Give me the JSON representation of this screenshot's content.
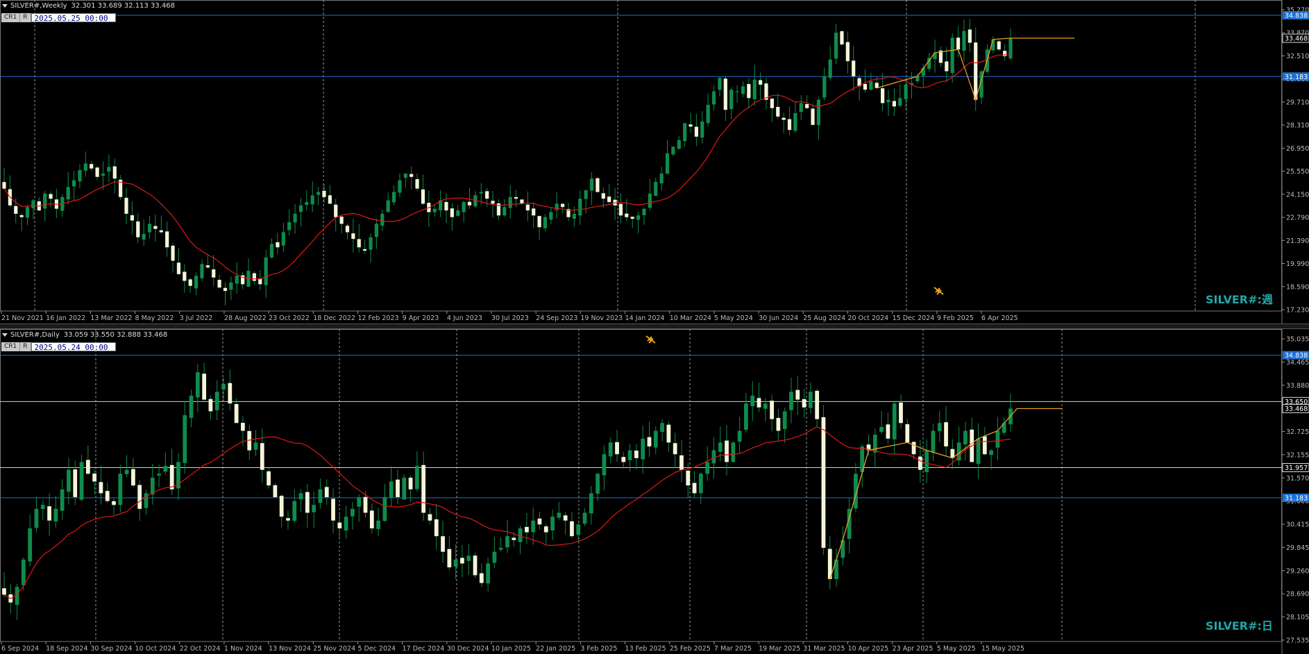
{
  "panes": [
    {
      "id": "top",
      "symbol_header": "SILVER#,Weekly",
      "ohlc": "32.301 33.689 32.113 33.468",
      "badges": [
        "CR1",
        "R"
      ],
      "datetime": "2025.05.25 00:00",
      "watermark": "SILVER#:週",
      "price_range": [
        17.2,
        35.5
      ],
      "price_ticks": [
        "35.270",
        "33.870",
        "32.510",
        "31.110",
        "29.710",
        "28.310",
        "26.950",
        "25.550",
        "24.150",
        "22.790",
        "21.390",
        "19.990",
        "18.590",
        "17.230"
      ],
      "time_labels": [
        "21 Nov 2021",
        "16 Jan 2022",
        "13 Mar 2022",
        "8 May 2022",
        "3 Jul 2022",
        "28 Aug 2022",
        "23 Oct 2022",
        "18 Dec 2022",
        "12 Feb 2023",
        "9 Apr 2023",
        "4 Jun 2023",
        "30 Jul 2023",
        "24 Sep 2023",
        "19 Nov 2023",
        "14 Jan 2024",
        "10 Mar 2024",
        "5 May 2024",
        "30 Jun 2024",
        "25 Aug 2024",
        "20 Oct 2024",
        "15 Dec 2024",
        "9 Feb 2025",
        "6 Apr 2025"
      ],
      "hlines": [
        {
          "price": 34.838,
          "label": "34.838",
          "color": "#1e6fd0"
        },
        {
          "price": 31.183,
          "label": "31.183",
          "color": "#1e6fd0"
        }
      ],
      "current_price": "33.468",
      "closes": [
        24.5,
        23.5,
        23.0,
        22.8,
        23.4,
        23.8,
        23.2,
        24.2,
        23.9,
        23.3,
        24.0,
        24.6,
        25.0,
        25.6,
        26.0,
        25.7,
        25.2,
        25.4,
        25.8,
        25.1,
        24.0,
        23.0,
        22.6,
        21.6,
        21.8,
        22.4,
        22.1,
        21.9,
        21.0,
        20.2,
        19.4,
        19.0,
        18.7,
        19.3,
        20.0,
        19.8,
        19.2,
        18.6,
        18.4,
        18.9,
        19.3,
        18.8,
        19.6,
        19.0,
        18.8,
        20.4,
        21.2,
        21.0,
        21.9,
        22.5,
        23.0,
        23.5,
        23.7,
        24.1,
        24.3,
        24.0,
        23.6,
        22.8,
        22.4,
        21.9,
        21.5,
        21.0,
        20.8,
        21.6,
        22.4,
        23.0,
        23.8,
        24.3,
        25.0,
        25.4,
        25.2,
        24.5,
        23.6,
        23.1,
        23.3,
        23.8,
        23.2,
        22.8,
        23.2,
        23.7,
        23.5,
        24.1,
        24.3,
        23.9,
        23.6,
        22.9,
        23.4,
        24.0,
        23.9,
        23.6,
        23.2,
        22.9,
        22.2,
        22.8,
        23.1,
        23.6,
        23.4,
        22.8,
        23.0,
        23.9,
        24.4,
        25.1,
        24.3,
        23.9,
        23.7,
        23.5,
        22.9,
        22.8,
        22.7,
        22.9,
        23.3,
        24.2,
        24.9,
        25.4,
        26.6,
        27.0,
        27.4,
        28.4,
        28.2,
        27.6,
        28.5,
        29.5,
        30.3,
        31.1,
        29.2,
        30.4,
        30.3,
        30.6,
        29.9,
        31.0,
        30.7,
        29.8,
        29.3,
        28.8,
        28.6,
        28.0,
        29.0,
        29.6,
        29.3,
        28.3,
        29.8,
        31.2,
        32.2,
        33.8,
        33.1,
        32.1,
        31.2,
        30.6,
        30.4,
        30.9,
        30.5,
        29.6,
        29.8,
        29.4,
        29.9,
        30.7,
        30.8,
        31.2,
        31.7,
        32.3,
        32.6,
        32.0,
        31.5,
        33.5,
        32.8,
        33.9,
        33.2,
        29.8,
        31.5,
        32.8,
        33.4,
        32.8,
        32.4,
        33.47
      ]
    },
    {
      "id": "bottom",
      "symbol_header": "SILVER#,Daily",
      "ohlc": "33.059 33.550 32.888 33.468",
      "badges": [
        "CR1",
        "R"
      ],
      "datetime": "2025.05.24 00:00",
      "watermark": "SILVER#:日",
      "price_range": [
        27.5,
        35.4
      ],
      "price_ticks": [
        "35.035",
        "34.465",
        "33.880",
        "33.310",
        "32.725",
        "32.155",
        "31.570",
        "31.000",
        "30.415",
        "29.845",
        "29.260",
        "28.690",
        "28.105",
        "27.535"
      ],
      "time_labels": [
        "6 Sep 2024",
        "18 Sep 2024",
        "30 Sep 2024",
        "10 Oct 2024",
        "22 Oct 2024",
        "1 Nov 2024",
        "13 Nov 2024",
        "25 Nov 2024",
        "5 Dec 2024",
        "17 Dec 2024",
        "30 Dec 2024",
        "10 Jan 2025",
        "22 Jan 2025",
        "3 Feb 2025",
        "13 Feb 2025",
        "25 Feb 2025",
        "7 Mar 2025",
        "19 Mar 2025",
        "31 Mar 2025",
        "10 Apr 2025",
        "23 Apr 2025",
        "5 May 2025",
        "15 May 2025"
      ],
      "hlines": [
        {
          "price": 34.838,
          "label": "34.838",
          "color": "#1e6fd0"
        },
        {
          "price": 33.65,
          "label": "33.650",
          "color": "#d0d0d0"
        },
        {
          "price": 31.957,
          "label": "31.957",
          "color": "#d0d0d0"
        },
        {
          "price": 31.183,
          "label": "31.183",
          "color": "#1e6fd0"
        }
      ],
      "current_price": "33.468",
      "closes": [
        28.7,
        28.5,
        28.9,
        29.6,
        30.4,
        30.9,
        31.0,
        30.6,
        30.9,
        31.4,
        31.9,
        31.2,
        32.1,
        31.8,
        31.6,
        31.3,
        31.1,
        31.0,
        31.8,
        31.9,
        31.5,
        30.9,
        31.3,
        31.7,
        31.8,
        32.0,
        31.4,
        32.1,
        33.3,
        33.8,
        34.4,
        33.7,
        33.4,
        33.9,
        34.1,
        33.6,
        33.1,
        32.9,
        32.4,
        32.6,
        31.9,
        31.5,
        31.2,
        30.7,
        30.6,
        31.1,
        31.3,
        30.8,
        31.0,
        31.4,
        31.2,
        30.6,
        30.4,
        30.7,
        30.9,
        31.2,
        30.8,
        30.4,
        30.6,
        31.2,
        31.6,
        31.2,
        31.7,
        31.4,
        32.0,
        30.8,
        30.6,
        30.2,
        29.8,
        29.4,
        29.6,
        29.5,
        29.7,
        29.2,
        29.0,
        29.5,
        29.8,
        29.9,
        30.2,
        30.1,
        30.4,
        30.3,
        30.6,
        30.5,
        30.3,
        30.7,
        30.8,
        30.6,
        30.2,
        30.5,
        30.8,
        31.3,
        31.8,
        32.3,
        32.6,
        32.3,
        32.1,
        32.4,
        32.2,
        32.7,
        32.5,
        32.9,
        33.1,
        32.6,
        32.3,
        31.9,
        31.5,
        31.3,
        31.8,
        32.1,
        32.4,
        32.6,
        32.1,
        32.6,
        32.9,
        33.6,
        33.8,
        33.5,
        33.6,
        33.2,
        32.9,
        33.4,
        33.9,
        33.7,
        33.5,
        33.9,
        33.2,
        29.9,
        29.1,
        29.6,
        30.1,
        30.9,
        31.8,
        32.5,
        32.4,
        32.8,
        33.0,
        32.7,
        33.6,
        33.1,
        32.6,
        32.3,
        31.9,
        32.4,
        32.9,
        33.1,
        32.5,
        32.2,
        32.6,
        32.9,
        32.1,
        32.7,
        32.3,
        32.4,
        32.9,
        33.1,
        33.47
      ]
    }
  ]
}
